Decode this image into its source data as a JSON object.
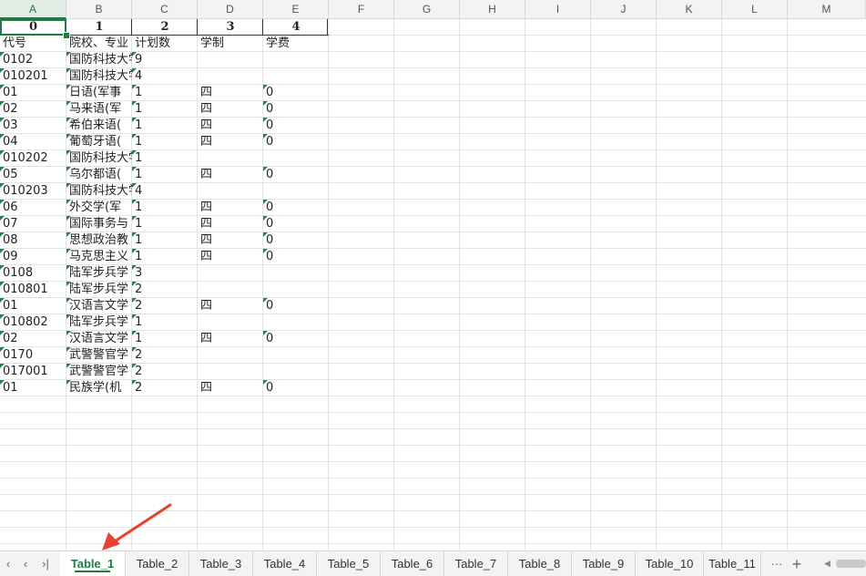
{
  "columns": [
    "A",
    "B",
    "C",
    "D",
    "E",
    "F",
    "G",
    "H",
    "I",
    "J",
    "K",
    "L",
    "M"
  ],
  "header_row": [
    "0",
    "1",
    "2",
    "3",
    "4"
  ],
  "title_row": [
    "代号",
    "院校、专业",
    "计划数",
    "学制",
    "学费"
  ],
  "rows": [
    [
      "0102",
      "国防科技大学",
      "9",
      "",
      ""
    ],
    [
      "010201",
      "国防科技大学",
      "4",
      "",
      ""
    ],
    [
      "01",
      "日语(军事",
      "1",
      "四",
      "0"
    ],
    [
      "02",
      "马来语(军",
      "1",
      "四",
      "0"
    ],
    [
      "03",
      "希伯来语(",
      "1",
      "四",
      "0"
    ],
    [
      "04",
      "葡萄牙语(",
      "1",
      "四",
      "0"
    ],
    [
      "010202",
      "国防科技大学",
      "1",
      "",
      ""
    ],
    [
      "05",
      "乌尔都语(",
      "1",
      "四",
      "0"
    ],
    [
      "010203",
      "国防科技大学",
      "4",
      "",
      ""
    ],
    [
      "06",
      "外交学(军",
      "1",
      "四",
      "0"
    ],
    [
      "07",
      "国际事务与",
      "1",
      "四",
      "0"
    ],
    [
      "08",
      "思想政治教",
      "1",
      "四",
      "0"
    ],
    [
      "09",
      "马克思主义",
      "1",
      "四",
      "0"
    ],
    [
      "0108",
      "陆军步兵学",
      "3",
      "",
      ""
    ],
    [
      "010801",
      "陆军步兵学",
      "2",
      "",
      ""
    ],
    [
      "01",
      "汉语言文学",
      "2",
      "四",
      "0"
    ],
    [
      "010802",
      "陆军步兵学",
      "1",
      "",
      ""
    ],
    [
      "02",
      "汉语言文学",
      "1",
      "四",
      "0"
    ],
    [
      "0170",
      "武警警官学",
      "2",
      "",
      ""
    ],
    [
      "017001",
      "武警警官学",
      "2",
      "",
      ""
    ],
    [
      "01",
      "民族学(机",
      "2",
      "四",
      "0"
    ]
  ],
  "tabs": [
    "Table_1",
    "Table_2",
    "Table_3",
    "Table_4",
    "Table_5",
    "Table_6",
    "Table_7",
    "Table_8",
    "Table_9",
    "Table_10",
    "Table_11"
  ],
  "active_tab": "Table_1",
  "nav": {
    "first": "‹",
    "prev": "‹",
    "next": "›",
    "last": "›|",
    "more": "···",
    "add": "+"
  },
  "colors": {
    "accent": "#1e7b41",
    "arrow": "#e8412f",
    "note_triangle": "#1f8a3e"
  }
}
